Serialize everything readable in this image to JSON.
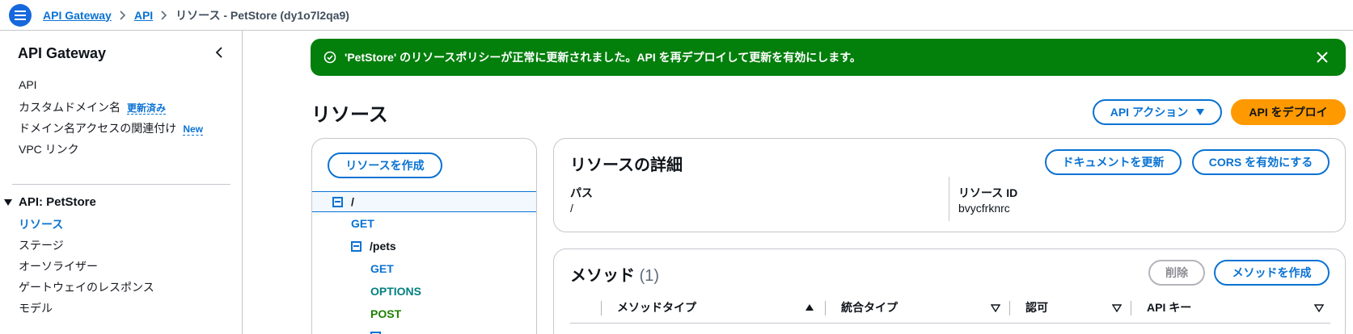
{
  "breadcrumbs": {
    "items": [
      "API Gateway",
      "API"
    ],
    "current": "リソース - PetStore (dy1o7l2qa9)"
  },
  "sidebar": {
    "title": "API Gateway",
    "items": [
      {
        "label": "API"
      },
      {
        "label": "カスタムドメイン名",
        "badge": "更新済み"
      },
      {
        "label": "ドメイン名アクセスの関連付け",
        "badge": "New"
      },
      {
        "label": "VPC リンク"
      }
    ],
    "section": {
      "title": "API: PetStore",
      "items": [
        "リソース",
        "ステージ",
        "オーソライザー",
        "ゲートウェイのレスポンス",
        "モデル"
      ]
    }
  },
  "flash": {
    "message": "'PetStore' のリソースポリシーが正常に更新されました。API を再デプロイして更新を有効にします。",
    "color": "#037f0c"
  },
  "page": {
    "title": "リソース",
    "api_actions_label": "API アクション",
    "deploy_label": "API をデプロイ"
  },
  "tree": {
    "create_label": "リソースを作成",
    "nodes": [
      {
        "type": "path",
        "label": "/"
      },
      {
        "type": "method",
        "label": "GET"
      },
      {
        "type": "path",
        "label": "/pets"
      },
      {
        "type": "method",
        "label": "GET"
      },
      {
        "type": "method",
        "label": "OPTIONS"
      },
      {
        "type": "method",
        "label": "POST"
      }
    ]
  },
  "details": {
    "title": "リソースの詳細",
    "update_docs_label": "ドキュメントを更新",
    "enable_cors_label": "CORS を有効にする",
    "path_label": "パス",
    "path_value": "/",
    "id_label": "リソース ID",
    "id_value": "bvycfrknrc"
  },
  "methods": {
    "title": "メソッド",
    "count": "(1)",
    "delete_label": "削除",
    "create_label": "メソッドを作成",
    "columns": [
      "メソッドタイプ",
      "統合タイプ",
      "認可",
      "API キー"
    ]
  },
  "colors": {
    "accent": "#0972d3",
    "success": "#037f0c",
    "deploy": "#ff9900"
  }
}
